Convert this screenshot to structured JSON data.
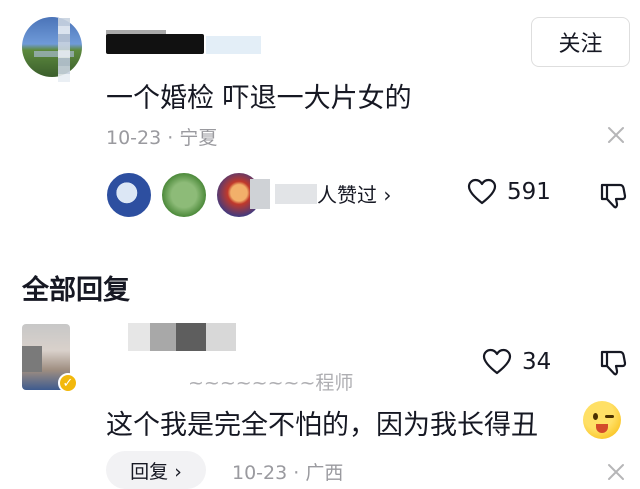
{
  "comment": {
    "follow_label": "关注",
    "text": "一个婚检 吓退一大片女的",
    "date": "10-23",
    "separator": "·",
    "location": "宁夏",
    "likers_label": "人赞过 ›",
    "like_count": "591"
  },
  "replies_section": {
    "title": "全部回复"
  },
  "reply": {
    "subtitle": "~~~~~~~~程师",
    "like_count": "34",
    "text": "这个我是完全不怕的，因为我长得丑",
    "reply_button_label": "回复 ›",
    "date": "10-23",
    "separator": "·",
    "location": "广西"
  },
  "icons": {
    "heart": "heart-icon",
    "dislike": "dislike-icon",
    "close": "close-icon",
    "verified": "verified-badge-icon",
    "emoji": "wink-emoji"
  }
}
